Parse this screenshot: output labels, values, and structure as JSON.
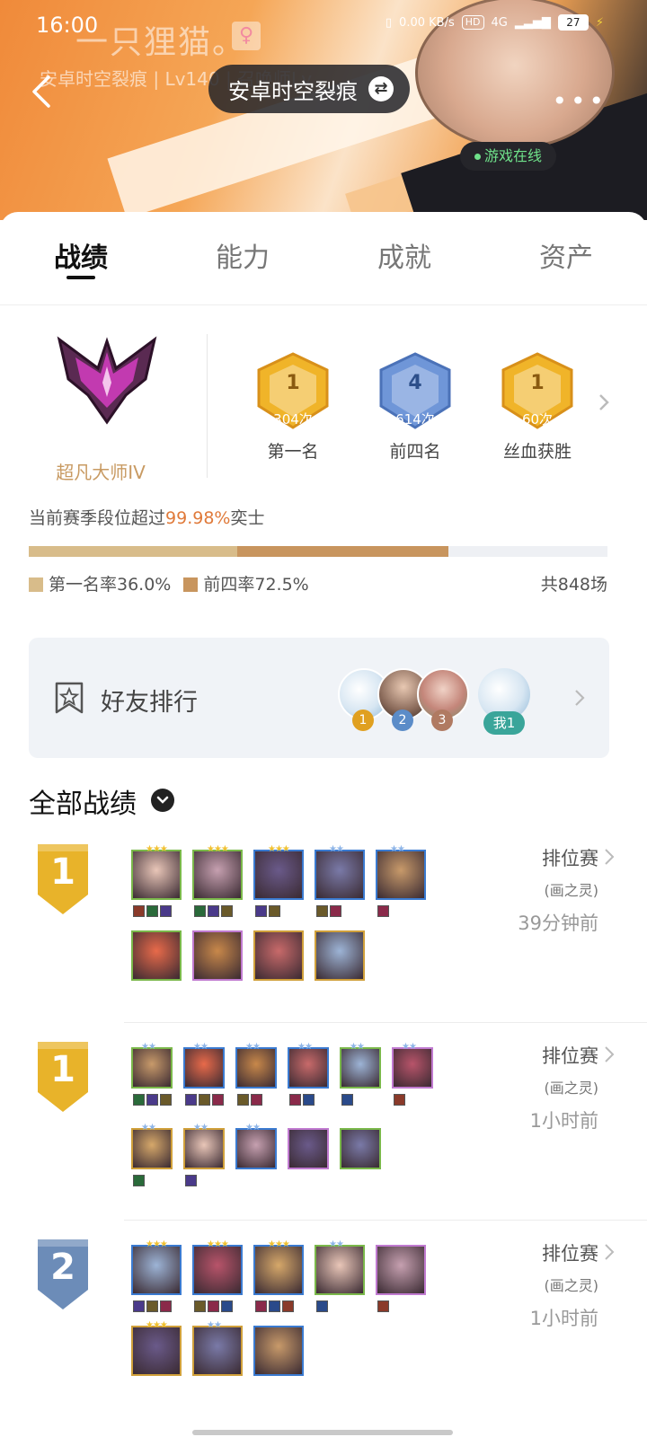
{
  "status": {
    "time": "16:00",
    "net_speed": "0.00",
    "net_unit": "KB/s",
    "hd": "HD",
    "network": "4G",
    "battery": "27"
  },
  "profile": {
    "nickname": "一只狸猫。",
    "subline": "安卓时空裂痕 | Lv140 | 召唤师Lv",
    "server": "安卓时空裂痕",
    "online_status": "游戏在线"
  },
  "tabs": [
    "战绩",
    "能力",
    "成就",
    "资产"
  ],
  "rank": {
    "name": "超凡大师IV"
  },
  "medals": [
    {
      "num": "1",
      "count": "304次",
      "label": "第一名",
      "color": "#f0b429"
    },
    {
      "num": "4",
      "count": "614次",
      "label": "前四名",
      "color": "#6f96d8"
    },
    {
      "num": "1",
      "count": "60次",
      "label": "丝血获胜",
      "color": "#f0b429"
    }
  ],
  "season": {
    "prefix": "当前赛季段位超过",
    "percent": "99.98%",
    "suffix": "奕士"
  },
  "rates": {
    "first_label": "第一名率36.0%",
    "first_rate": 0.36,
    "top4_label": "前四率72.5%",
    "top4_rate": 0.725,
    "total": "共848场"
  },
  "friend_rank": {
    "label": "好友排行",
    "badges": [
      "1",
      "2",
      "3"
    ],
    "me": "我1"
  },
  "all_records": {
    "title": "全部战绩"
  },
  "matches": [
    {
      "place": "1",
      "type": "排位赛",
      "mode": "(画之灵)",
      "time": "39分钟前",
      "units": [
        {
          "stars": "★★★",
          "items": 3
        },
        {
          "stars": "★★★",
          "items": 3
        },
        {
          "stars": "★★★",
          "items": 2
        },
        {
          "stars": "★★",
          "items": 2
        },
        {
          "stars": "★★",
          "items": 1
        },
        {
          "stars": "",
          "items": 0
        },
        {
          "stars": "",
          "items": 0
        },
        {
          "stars": "",
          "items": 0
        },
        {
          "stars": "",
          "items": 0
        }
      ]
    },
    {
      "place": "1",
      "type": "排位赛",
      "mode": "(画之灵)",
      "time": "1小时前",
      "units": [
        {
          "stars": "★★",
          "items": 3
        },
        {
          "stars": "★★",
          "items": 3
        },
        {
          "stars": "★★",
          "items": 2
        },
        {
          "stars": "★★",
          "items": 2
        },
        {
          "stars": "★★",
          "items": 1
        },
        {
          "stars": "★★",
          "items": 1
        },
        {
          "stars": "★★",
          "items": 1
        },
        {
          "stars": "★★",
          "items": 1
        },
        {
          "stars": "★★",
          "items": 0
        },
        {
          "stars": "",
          "items": 0
        },
        {
          "stars": "",
          "items": 0
        }
      ]
    },
    {
      "place": "2",
      "type": "排位赛",
      "mode": "(画之灵)",
      "time": "1小时前",
      "units": [
        {
          "stars": "★★★",
          "items": 3
        },
        {
          "stars": "★★★",
          "items": 3
        },
        {
          "stars": "★★★",
          "items": 3
        },
        {
          "stars": "★★",
          "items": 1
        },
        {
          "stars": "",
          "items": 1
        },
        {
          "stars": "★★★",
          "items": 0
        },
        {
          "stars": "★★",
          "items": 0
        },
        {
          "stars": "",
          "items": 0
        }
      ]
    }
  ]
}
